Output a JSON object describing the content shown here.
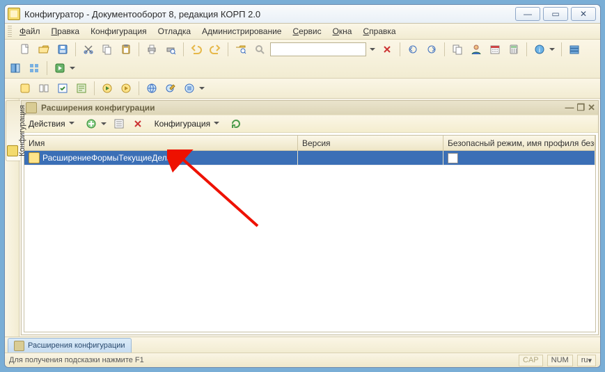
{
  "window": {
    "title": "Конфигуратор - Документооборот 8, редакция КОРП 2.0"
  },
  "menu": {
    "file": {
      "text": "Файл",
      "underline_index": 0
    },
    "edit": {
      "text": "Правка",
      "underline_index": 0
    },
    "config": {
      "text": "Конфигурация",
      "underline_index": -1
    },
    "debug": {
      "text": "Отладка",
      "underline_index": -1
    },
    "admin": {
      "text": "Администрирование",
      "underline_index": -1
    },
    "service": {
      "text": "Сервис",
      "underline_index": 0
    },
    "windows": {
      "text": "Окна",
      "underline_index": 0
    },
    "help": {
      "text": "Справка",
      "underline_index": 0
    }
  },
  "toolbar1": {
    "search_value": ""
  },
  "side_tab": {
    "label": "Конфигурация"
  },
  "child_window": {
    "title": "Расширения конфигурации"
  },
  "child_toolbar": {
    "actions_label": "Действия",
    "config_label": "Конфигурация"
  },
  "grid": {
    "columns": {
      "name": "Имя",
      "version": "Версия",
      "safe": "Безопасный режим, имя профиля безоп..."
    },
    "rows": [
      {
        "name": "РасширениеФормыТекущиеДела",
        "version": "",
        "safe_checked": false
      }
    ]
  },
  "bottom_tab": {
    "label": "Расширения конфигурации"
  },
  "status": {
    "hint": "Для получения подсказки нажмите F1",
    "cap": "CAP",
    "num": "NUM",
    "lang": "ru"
  },
  "icons": {}
}
